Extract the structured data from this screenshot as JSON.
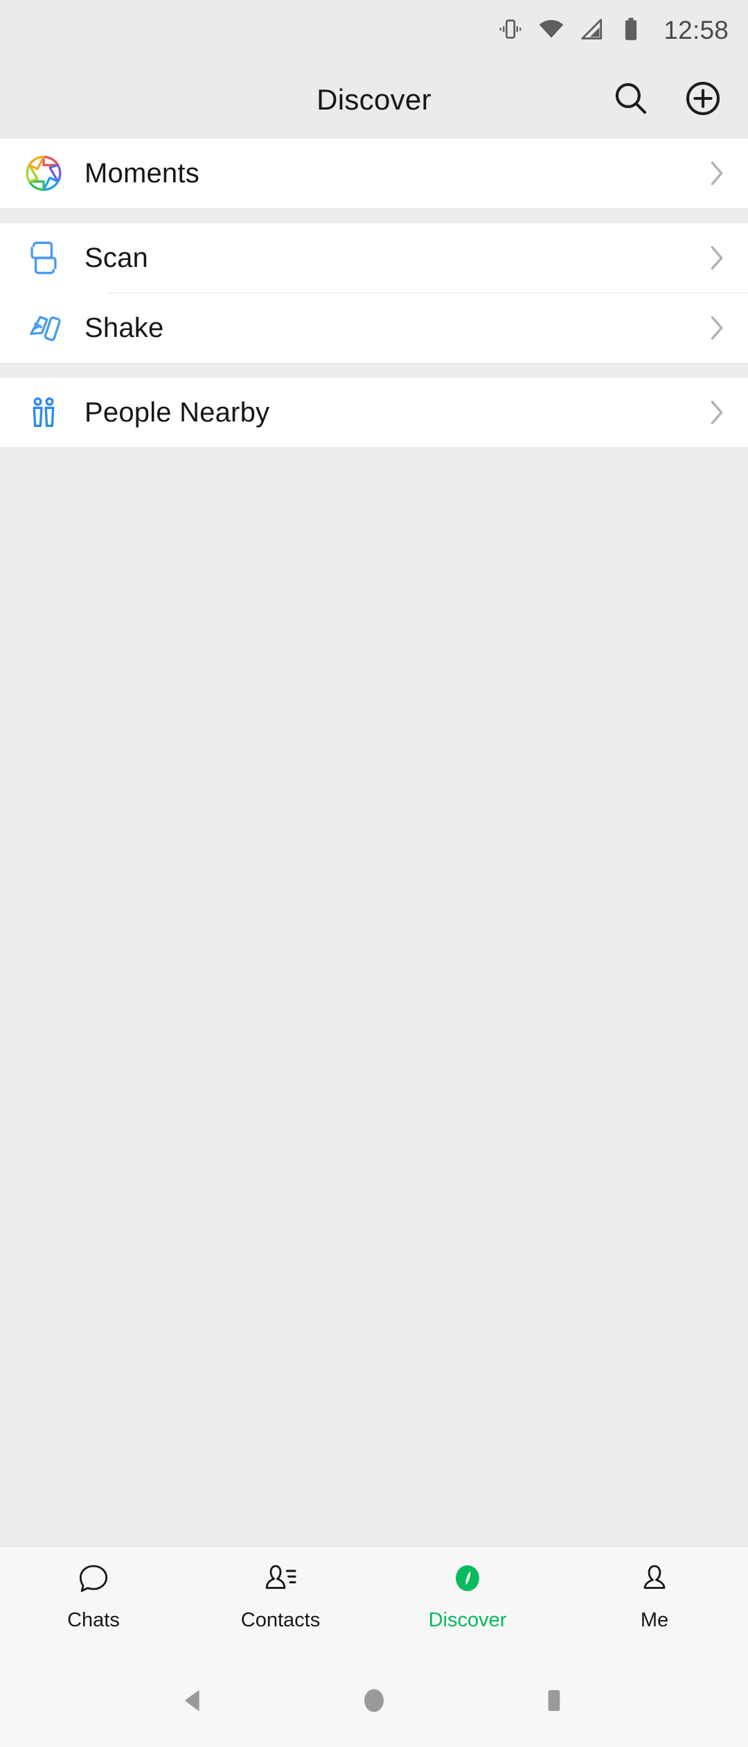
{
  "statusbar": {
    "time": "12:58",
    "icons": [
      "vibrate-icon",
      "wifi-icon",
      "cellular-signal-icon",
      "battery-icon"
    ]
  },
  "header": {
    "title": "Discover",
    "search_icon": "search-icon",
    "add_icon": "add-circle-icon"
  },
  "sections": [
    {
      "items": [
        {
          "label": "Moments",
          "icon": "moments-aperture-icon",
          "chevron": "chevron-right-icon"
        }
      ]
    },
    {
      "items": [
        {
          "label": "Scan",
          "icon": "scan-icon",
          "chevron": "chevron-right-icon"
        },
        {
          "label": "Shake",
          "icon": "shake-icon",
          "chevron": "chevron-right-icon"
        }
      ]
    },
    {
      "items": [
        {
          "label": "People Nearby",
          "icon": "people-nearby-icon",
          "chevron": "chevron-right-icon"
        }
      ]
    }
  ],
  "tabbar": {
    "tabs": [
      {
        "label": "Chats",
        "icon": "chat-bubble-icon",
        "active": false
      },
      {
        "label": "Contacts",
        "icon": "contacts-icon",
        "active": false
      },
      {
        "label": "Discover",
        "icon": "discover-compass-icon",
        "active": true
      },
      {
        "label": "Me",
        "icon": "person-icon",
        "active": false
      }
    ],
    "active_color": "#09bb5f"
  },
  "androidnav": {
    "back": "back-triangle-icon",
    "home": "home-circle-icon",
    "recents": "recents-square-icon"
  },
  "colors": {
    "background": "#ededed",
    "card": "#ffffff",
    "accent_green": "#09bb5f",
    "icon_blue": "#4a9bf0",
    "text": "#161616"
  }
}
